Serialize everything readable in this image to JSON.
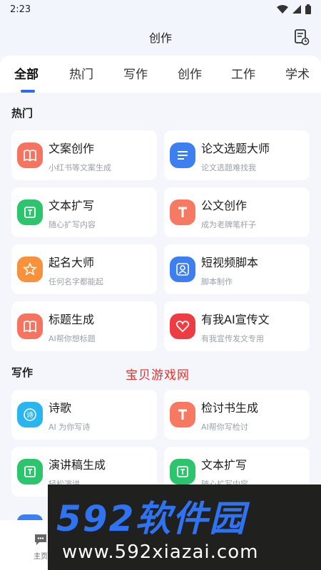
{
  "status_bar": {
    "time": "2:23"
  },
  "header": {
    "title": "创作"
  },
  "tabs": [
    "全部",
    "热门",
    "写作",
    "创作",
    "工作",
    "学术"
  ],
  "sections": {
    "hot": {
      "title": "热门",
      "cards": [
        {
          "title": "文案创作",
          "subtitle": "小红书等文案生成",
          "icon": "book-icon",
          "color": "#f5735f"
        },
        {
          "title": "论文选题大师",
          "subtitle": "论文选题难找我",
          "icon": "document-lines-icon",
          "color": "#3d7ef0"
        },
        {
          "title": "文本扩写",
          "subtitle": "随心扩写内容",
          "icon": "text-box-icon",
          "color": "#2cc46d"
        },
        {
          "title": "公文创作",
          "subtitle": "成为老牌笔杆子",
          "icon": "letter-t-icon",
          "color": "#f67a62"
        },
        {
          "title": "起名大师",
          "subtitle": "任何名字都能起",
          "icon": "star-badge-icon",
          "color": "#f7913b"
        },
        {
          "title": "短视频脚本",
          "subtitle": "脚本制作",
          "icon": "person-frame-icon",
          "color": "#3d7ef0"
        },
        {
          "title": "标题生成",
          "subtitle": "AI帮你想标题",
          "icon": "book-icon",
          "color": "#f5735f"
        },
        {
          "title": "有我AI宣传文",
          "subtitle": "有我宣传发文专用",
          "icon": "heart-icon",
          "color": "#ee3d42"
        }
      ]
    },
    "writing": {
      "title": "写作",
      "cards": [
        {
          "title": "诗歌",
          "subtitle": "AI 为你写诗",
          "icon": "poem-icon",
          "color": "#29b5ef"
        },
        {
          "title": "检讨书生成",
          "subtitle": "AI帮你写检讨",
          "icon": "letter-t-icon",
          "color": "#f67a62"
        },
        {
          "title": "演讲稿生成",
          "subtitle": "轻松演讲",
          "icon": "text-box-icon",
          "color": "#2cc46d"
        },
        {
          "title": "文本扩写",
          "subtitle": "随心扩写内容",
          "icon": "text-box-icon",
          "color": "#2cc46d"
        }
      ]
    }
  },
  "watermark_red": "宝贝游戏网",
  "bottom_nav": {
    "home_label": "主页"
  },
  "banner": {
    "brand": "592软件园",
    "url": "www.592xiazai.com"
  }
}
